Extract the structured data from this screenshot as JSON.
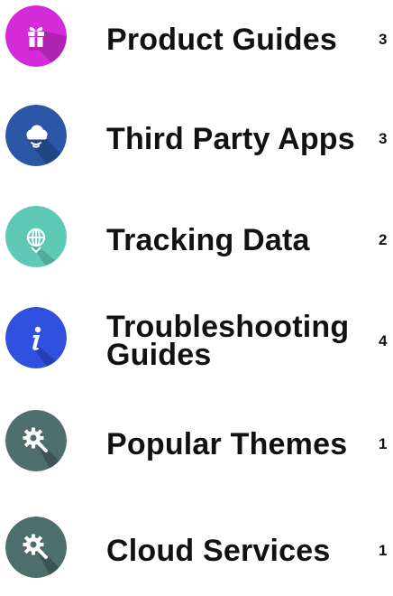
{
  "categories": [
    {
      "title": "Product Guides",
      "count": "3",
      "icon": "gift-icon",
      "color": "#d62bd8"
    },
    {
      "title": "Third Party Apps",
      "count": "3",
      "icon": "cloud-icon",
      "color": "#2c57a6"
    },
    {
      "title": "Tracking Data",
      "count": "2",
      "icon": "globe-icon",
      "color": "#5ec9b4"
    },
    {
      "title": "Troubleshooting Guides",
      "count": "4",
      "icon": "info-icon",
      "color": "#3050e0"
    },
    {
      "title": "Popular Themes",
      "count": "1",
      "icon": "gear-icon",
      "color": "#4e6e6c"
    },
    {
      "title": "Cloud Services",
      "count": "1",
      "icon": "gear-icon",
      "color": "#4e6e6c"
    }
  ]
}
